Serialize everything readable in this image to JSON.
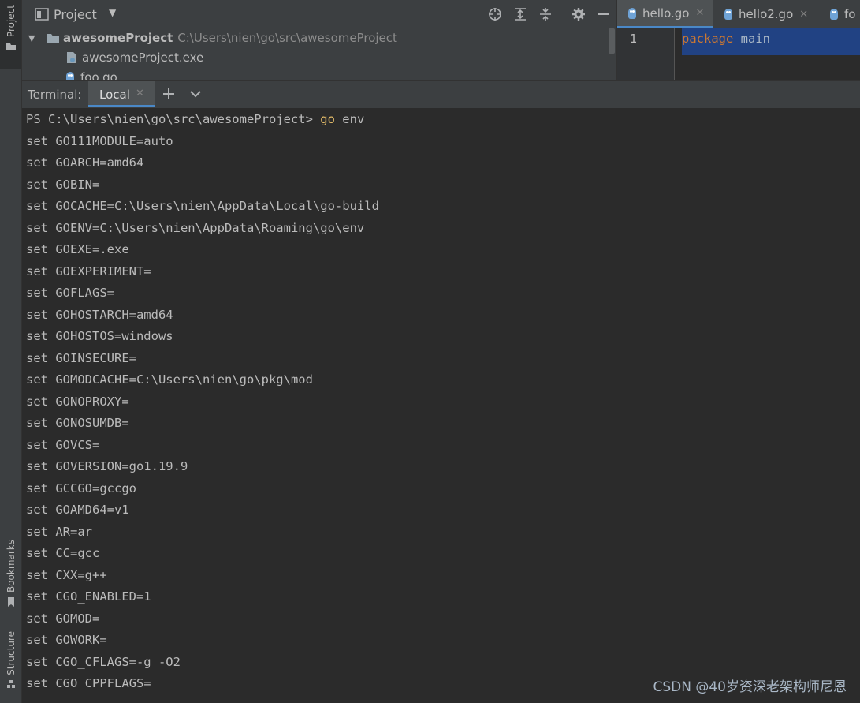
{
  "sidebar": {
    "project_tab": "Project",
    "bookmarks_tab": "Bookmarks",
    "structure_tab": "Structure"
  },
  "project_panel": {
    "title": "Project",
    "tree": {
      "root_name": "awesomeProject",
      "root_path": "C:\\Users\\nien\\go\\src\\awesomeProject",
      "children": [
        "awesomeProject.exe",
        "foo.go"
      ]
    }
  },
  "editor": {
    "tabs": [
      "hello.go",
      "hello2.go",
      "fo"
    ],
    "line_number": "1",
    "code_keyword": "package",
    "code_rest": "main"
  },
  "terminal": {
    "label": "Terminal:",
    "tab": "Local",
    "prompt": "PS C:\\Users\\nien\\go\\src\\awesomeProject> ",
    "command_keyword": "go",
    "command_rest": " env",
    "lines": [
      "set GO111MODULE=auto",
      "set GOARCH=amd64",
      "set GOBIN=",
      "set GOCACHE=C:\\Users\\nien\\AppData\\Local\\go-build",
      "set GOENV=C:\\Users\\nien\\AppData\\Roaming\\go\\env",
      "set GOEXE=.exe",
      "set GOEXPERIMENT=",
      "set GOFLAGS=",
      "set GOHOSTARCH=amd64",
      "set GOHOSTOS=windows",
      "set GOINSECURE=",
      "set GOMODCACHE=C:\\Users\\nien\\go\\pkg\\mod",
      "set GONOPROXY=",
      "set GONOSUMDB=",
      "set GOVCS=",
      "set GOVERSION=go1.19.9",
      "set GCCGO=gccgo",
      "set GOAMD64=v1",
      "set AR=ar",
      "set CC=gcc",
      "set CXX=g++",
      "set CGO_ENABLED=1",
      "set GOMOD=",
      "set GOWORK=",
      "set CGO_CFLAGS=-g -O2",
      "set CGO_CPPFLAGS="
    ]
  },
  "watermark": "CSDN @40岁资深老架构师尼恩",
  "colors": {
    "panel_bg": "#3c3f41",
    "editor_bg": "#2b2b2b",
    "keyword": "#cc7832",
    "command_highlight": "#e8bf6a",
    "selection": "#214283"
  }
}
